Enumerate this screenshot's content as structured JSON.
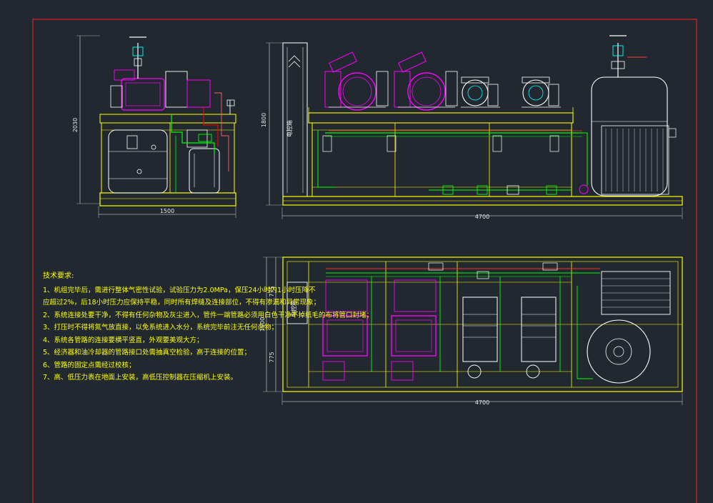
{
  "dimensions": {
    "side_height": "2030",
    "side_width": "1500",
    "front_height": "1800",
    "front_width": "4700",
    "plan_half_top": "775",
    "plan_half_bottom": "775",
    "plan_total_depth": "1600",
    "plan_width": "4700"
  },
  "labels": {
    "control_box_front": "电控箱",
    "control_box_plan": "电控箱"
  },
  "notes": {
    "title": "技术要求:",
    "items": [
      "1、机组完毕后，需进行整体气密性试验，试验压力为2.0MPa，保压24小时内1小时压降不",
      "应超过2%，后18小时压力应保持平稳，同时所有焊缝及连接部位，不得有渗漏和异常现象；",
      "2、系统连接处要干净，不得有任何杂物及灰尘进入，管件一端管路必须用白色干净不掉纸毛的布将管口封堵；",
      "3、打压时不得将氮气放直接，以免系统进入水分，系统完毕前注无任何杂物；",
      "4、系统各管路的连接要横平竖直，外观要美观大方；",
      "5、经济器和油冷却器的管路接口处需抽真空检验，高于连接的位置；",
      "6、管路的固定点需经过校核；",
      "7、高、低压力表在地面上安装，高低压控制器在压缩机上安装。"
    ]
  },
  "colors": {
    "background": "#212830",
    "frame": "#ff0000",
    "base": "#ffff00",
    "pipe": "#00ff00",
    "compressor": "#ff00ff",
    "equipment": "#ffffff",
    "dimension": "#c0c0c0",
    "text": "#ffff00"
  }
}
